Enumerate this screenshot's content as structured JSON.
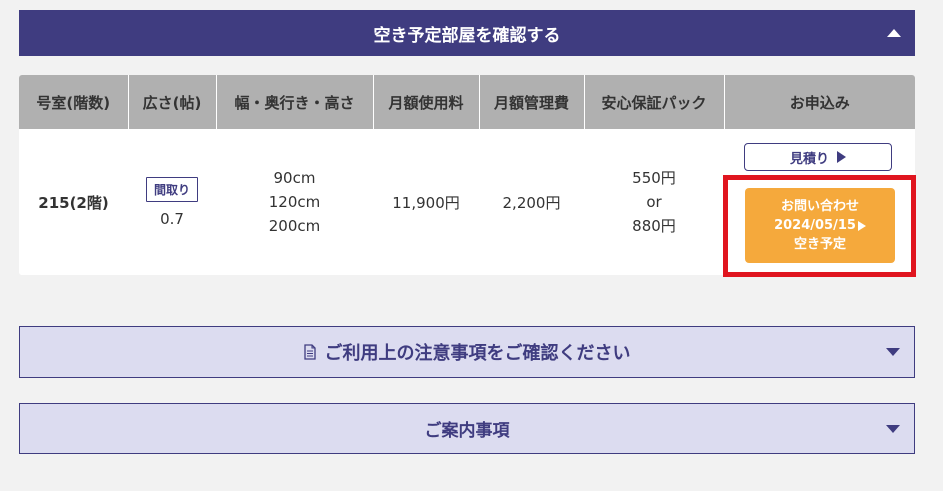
{
  "vacancy_section": {
    "title": "空き予定部屋を確認する"
  },
  "table": {
    "headers": [
      "号室(階数)",
      "広さ(帖)",
      "幅・奥行き・高さ",
      "月額使用料",
      "月額管理費",
      "安心保証パック",
      "お申込み"
    ],
    "row": {
      "room": "215(2階)",
      "floorplan_label": "間取り",
      "area": "0.7",
      "width": "90cm",
      "depth": "120cm",
      "height": "200cm",
      "monthly_fee": "11,900円",
      "management_fee": "2,200円",
      "guarantee_a": "550円",
      "guarantee_or": "or",
      "guarantee_b": "880円",
      "estimate_label": "見積り",
      "inquiry_line1": "お問い合わせ",
      "inquiry_line2": "2024/05/15",
      "inquiry_line3": "空き予定"
    }
  },
  "notes_section": {
    "title": "ご利用上の注意事項をご確認ください"
  },
  "info_section": {
    "title": "ご案内事項"
  },
  "colors": {
    "primary": "#3f3c80",
    "accent": "#f5a93c",
    "highlight": "#e0151f",
    "light": "#dcdcf0"
  },
  "icons": [
    "triangle-up-icon",
    "triangle-right-icon",
    "document-icon",
    "triangle-down-icon"
  ]
}
